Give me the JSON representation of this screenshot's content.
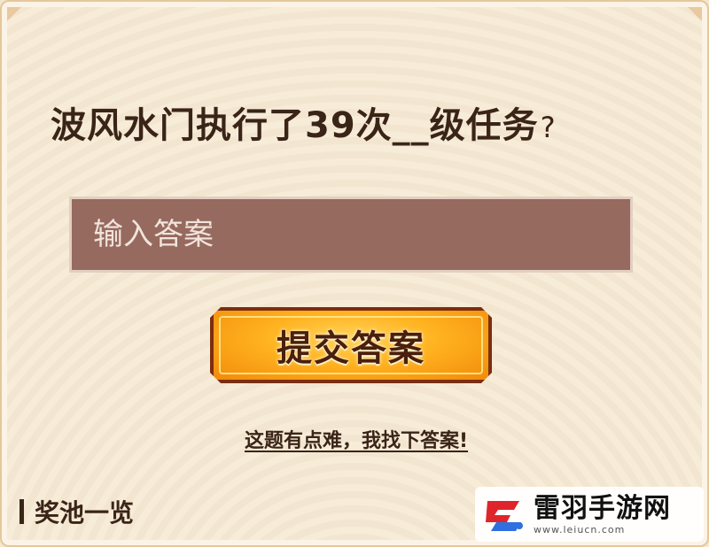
{
  "question": {
    "text": "波风水门执行了39次__级任务",
    "mark": "?"
  },
  "answer_input": {
    "placeholder": "输入答案",
    "value": ""
  },
  "submit_button": {
    "label": "提交答案"
  },
  "hint_link": {
    "label": "这题有点难，我找下答案!"
  },
  "prize_section": {
    "title": "奖池一览"
  },
  "watermark": {
    "name": "雷羽手游网",
    "url": "www.leiucn.com"
  },
  "colors": {
    "input_bg": "#966a5f",
    "button_fill": "#ffb21f",
    "button_border": "#7a2e12",
    "text_dark": "#3a2418",
    "logo_red": "#e0242b"
  }
}
